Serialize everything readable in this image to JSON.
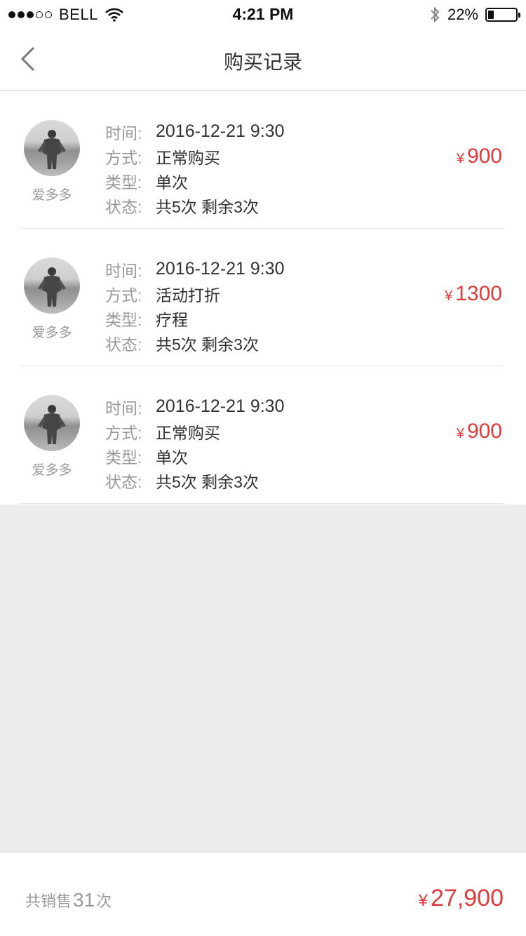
{
  "status_bar": {
    "carrier": "BELL",
    "time": "4:21 PM",
    "battery": "22%",
    "battery_level": 0.22,
    "signal_bars_filled": 3,
    "signal_bars_total": 5
  },
  "nav": {
    "title": "购买记录",
    "back_icon": "chevron-left-icon"
  },
  "records": [
    {
      "user": "爱多多",
      "time_label": "时间:",
      "time": "2016-12-21 9:30",
      "method_label": "方式:",
      "method": "正常购买",
      "type_label": "类型:",
      "type": "单次",
      "status_label": "状态:",
      "status": "共5次 剩余3次",
      "currency": "¥",
      "price": "900"
    },
    {
      "user": "爱多多",
      "time_label": "时间:",
      "time": "2016-12-21 9:30",
      "method_label": "方式:",
      "method": "活动打折",
      "type_label": "类型:",
      "type": "疗程",
      "status_label": "状态:",
      "status": "共5次 剩余3次",
      "currency": "¥",
      "price": "1300"
    },
    {
      "user": "爱多多",
      "time_label": "时间:",
      "time": "2016-12-21 9:30",
      "method_label": "方式:",
      "method": "正常购买",
      "type_label": "类型:",
      "type": "单次",
      "status_label": "状态:",
      "status": "共5次 剩余3次",
      "currency": "¥",
      "price": "900"
    }
  ],
  "summary": {
    "prefix": "共销售",
    "count": "31",
    "suffix": "次",
    "currency": "¥",
    "total": "27,900"
  },
  "colors": {
    "accent_red": "#e23a3a",
    "background": "#e9edf0"
  }
}
